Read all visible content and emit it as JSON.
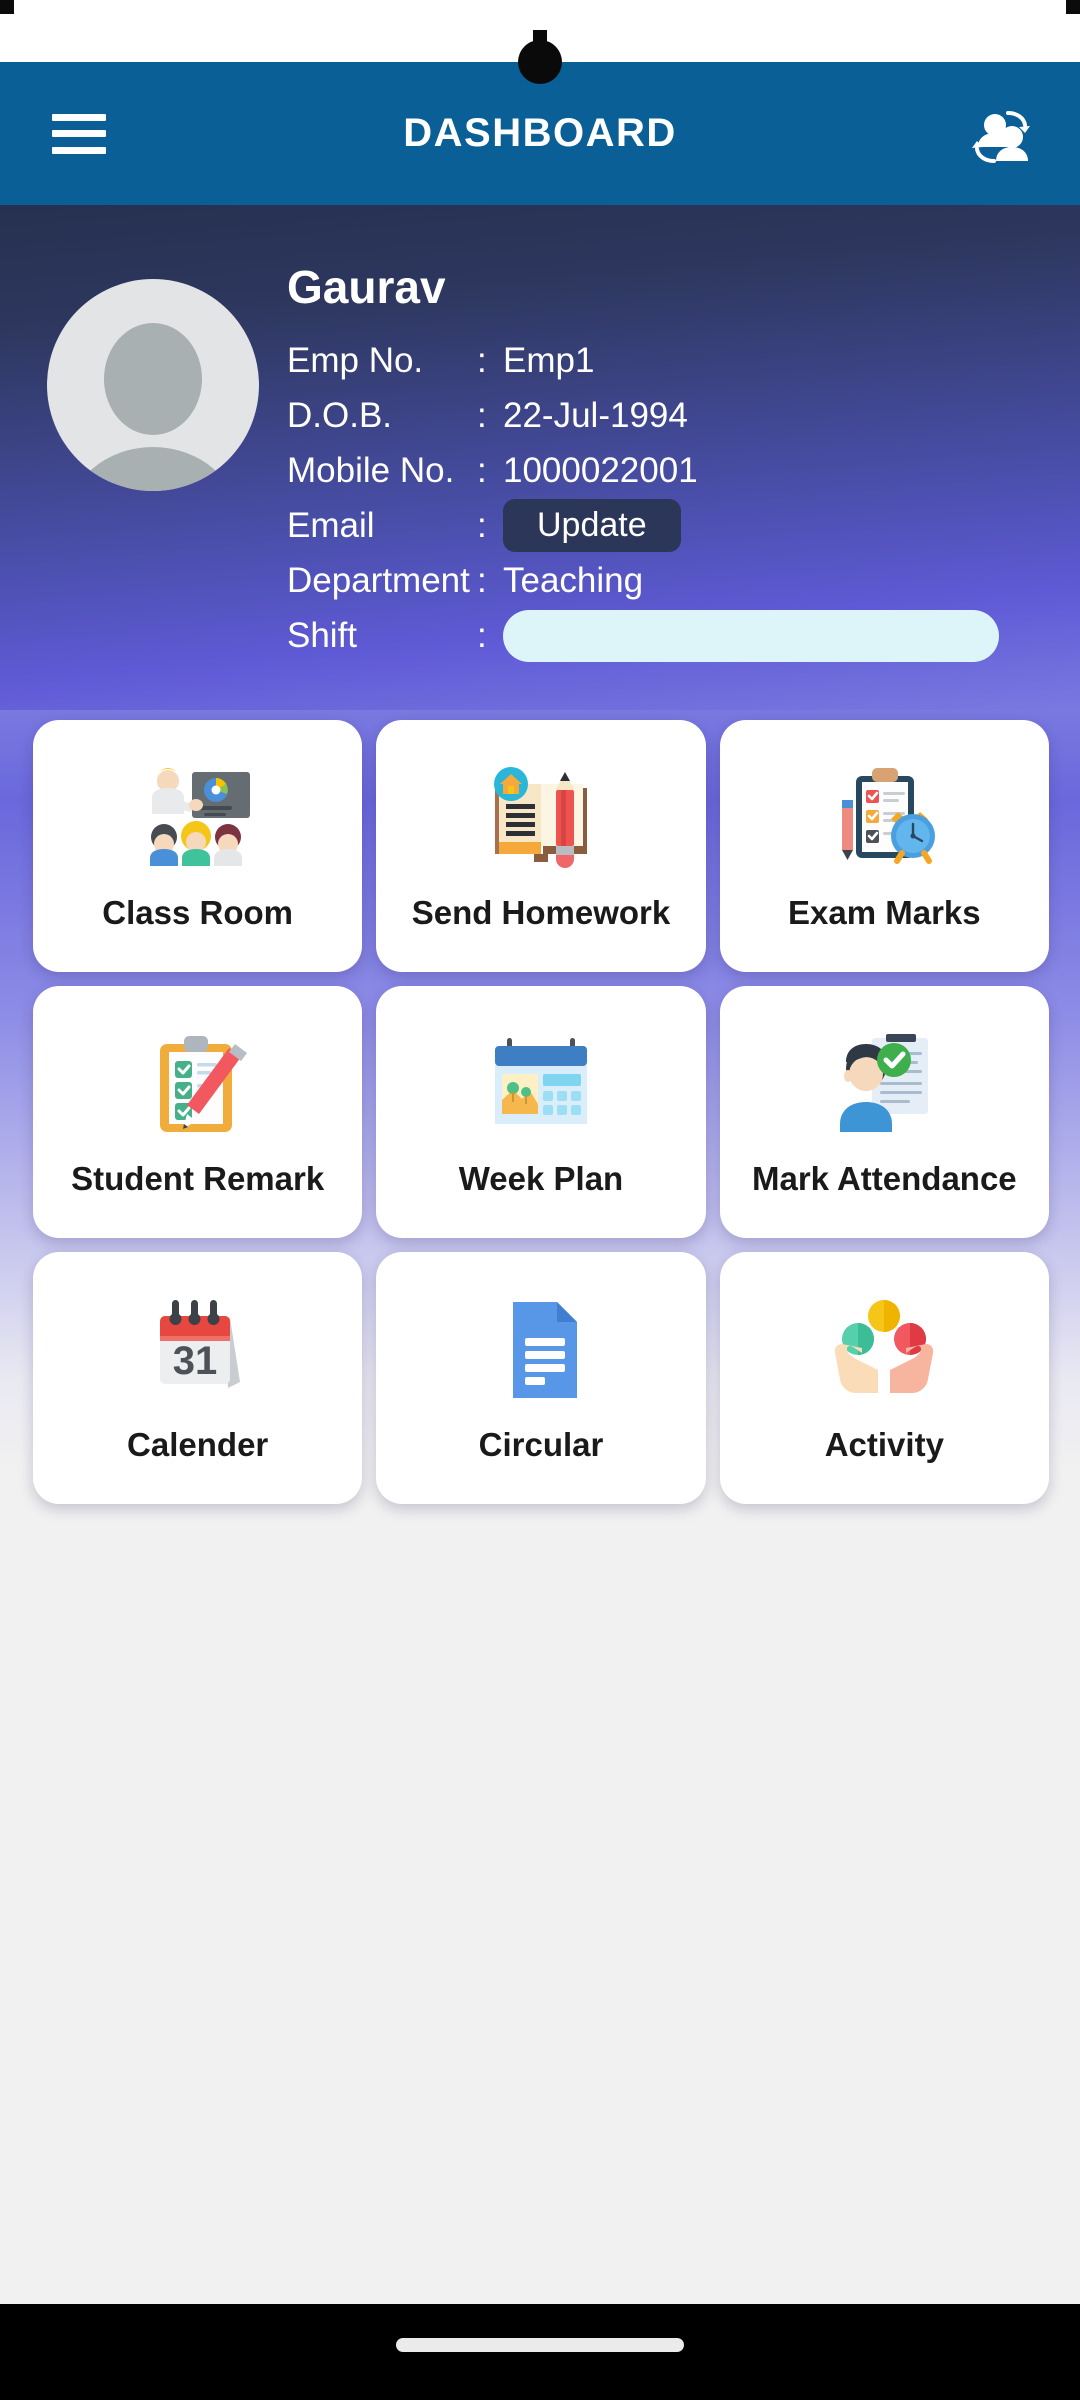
{
  "statusbar": {
    "notch": "camera-punch-hole"
  },
  "appbar": {
    "title": "DASHBOARD",
    "menu_icon": "hamburger-menu-icon",
    "switch_user_icon": "switch-user-icon",
    "background_color": "#0a5f96"
  },
  "profile": {
    "name": "Gaurav",
    "avatar_icon": "default-avatar-icon",
    "rows": [
      {
        "label": "Emp No.",
        "colon": ":",
        "value": "Emp1",
        "type": "text"
      },
      {
        "label": "D.O.B.",
        "colon": ":",
        "value": "22-Jul-1994",
        "type": "text"
      },
      {
        "label": "Mobile No.",
        "colon": ":",
        "value": "1000022001",
        "type": "text"
      },
      {
        "label": "Email",
        "colon": ":",
        "value": "Update",
        "type": "button"
      },
      {
        "label": "Department",
        "colon": ":",
        "value": "Teaching",
        "type": "text"
      },
      {
        "label": "Shift",
        "colon": ":",
        "value": "",
        "type": "field"
      }
    ],
    "update_button_color": "#2c3659",
    "shift_field_color": "#ddf5f8"
  },
  "grid": {
    "cards": [
      {
        "label": "Class Room",
        "icon": "classroom-icon"
      },
      {
        "label": "Send Homework",
        "icon": "homework-book-pencil-icon"
      },
      {
        "label": "Exam Marks",
        "icon": "clipboard-clock-icon"
      },
      {
        "label": "Student Remark",
        "icon": "checklist-pencil-icon"
      },
      {
        "label": "Week Plan",
        "icon": "calendar-plan-icon"
      },
      {
        "label": "Mark Attendance",
        "icon": "person-check-document-icon"
      },
      {
        "label": "Calender",
        "icon": "calendar-31-icon"
      },
      {
        "label": "Circular",
        "icon": "document-blue-icon"
      },
      {
        "label": "Activity",
        "icon": "hands-balls-icon"
      }
    ]
  },
  "navbar": {
    "gesture_pill": "home-gesture-pill"
  }
}
